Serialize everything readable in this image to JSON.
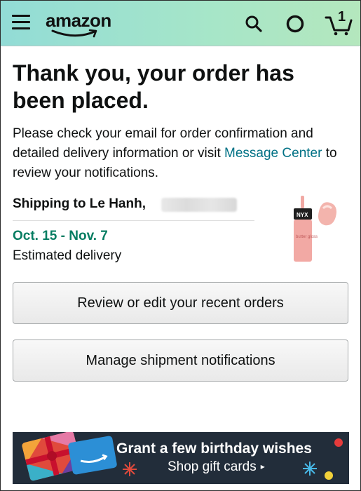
{
  "header": {
    "logo_text": "amazon",
    "cart_count": "1",
    "icons": [
      "menu-icon",
      "search-icon",
      "circle-icon",
      "cart-icon"
    ],
    "colors": {
      "gradient_start": "#92dcd6",
      "gradient_end": "#b4e7bd"
    }
  },
  "confirmation": {
    "title": "Thank you, your order has been placed.",
    "info_prefix": "Please check your email for order confirmation and detailed delivery information or visit ",
    "info_link": "Message Center",
    "info_suffix": " to review your notifications."
  },
  "shipping": {
    "label": "Shipping to Le Hanh,",
    "delivery_date": "Oct. 15 - Nov. 7",
    "delivery_caption": "Estimated delivery"
  },
  "product": {
    "brand_mark": "NYX",
    "product_text": "butter gloss"
  },
  "actions": {
    "review_orders": "Review or edit your recent orders",
    "manage_notifications": "Manage shipment notifications"
  },
  "banner": {
    "title": "Grant a few birthday wishes",
    "cta": "Shop gift cards",
    "cta_arrow": "▸"
  },
  "colors": {
    "link": "#007185",
    "delivery_green": "#067d62",
    "banner_bg": "#222d3a"
  }
}
